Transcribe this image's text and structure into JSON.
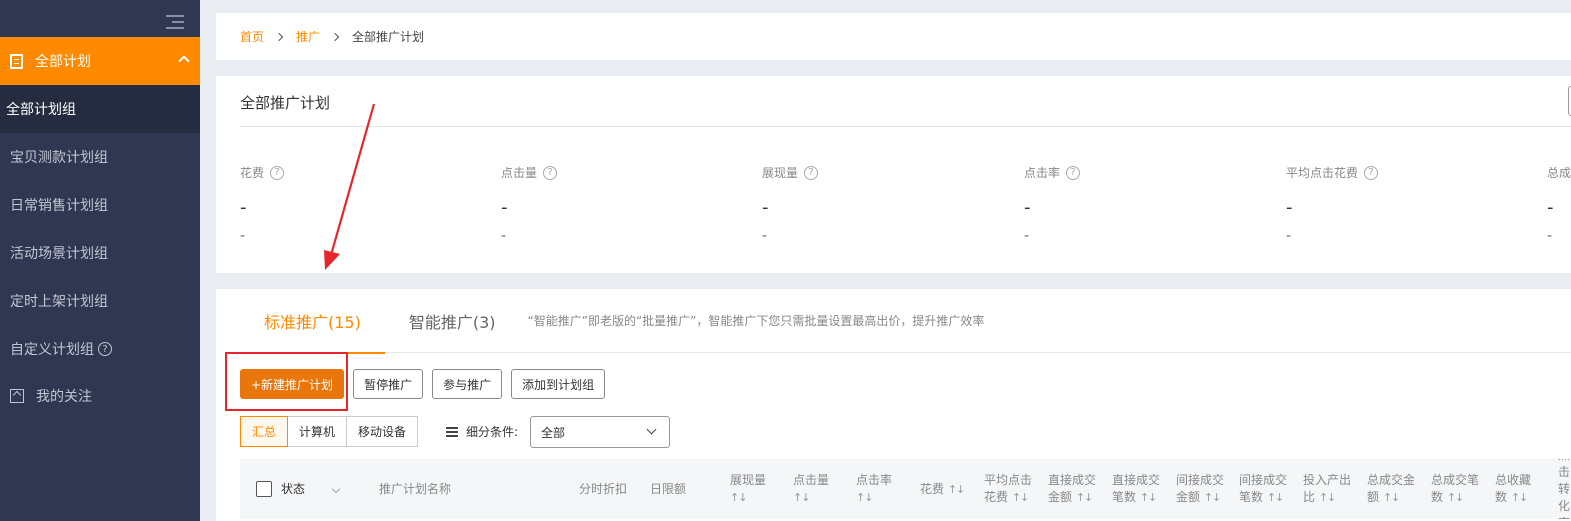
{
  "sidebar": {
    "header": "全部计划",
    "items": [
      {
        "label": "全部计划组"
      },
      {
        "label": "宝贝测款计划组"
      },
      {
        "label": "日常销售计划组"
      },
      {
        "label": "活动场景计划组"
      },
      {
        "label": "定时上架计划组"
      },
      {
        "label": "自定义计划组"
      }
    ],
    "bottom": "我的关注"
  },
  "breadcrumb": {
    "home": "首页",
    "promo": "推广",
    "current": "全部推广计划"
  },
  "overview": {
    "title": "全部推广计划",
    "metrics": [
      {
        "name": "花费",
        "v1": "-",
        "v2": "-"
      },
      {
        "name": "点击量",
        "v1": "-",
        "v2": "-"
      },
      {
        "name": "展现量",
        "v1": "-",
        "v2": "-"
      },
      {
        "name": "点击率",
        "v1": "-",
        "v2": "-"
      },
      {
        "name": "平均点击花费",
        "v1": "-",
        "v2": "-"
      },
      {
        "name": "总成",
        "v1": "-",
        "v2": "-"
      }
    ]
  },
  "tabs": {
    "standard": "标准推广(15)",
    "smart": "智能推广(3)",
    "note": "“智能推广”即老版的“批量推广”，智能推广下您只需批量设置最高出价，提升推广效率"
  },
  "buttons": {
    "new": "+新建推广计划",
    "pause": "暂停推广",
    "join": "参与推广",
    "add_group": "添加到计划组"
  },
  "segment": {
    "summary": "汇总",
    "pc": "计算机",
    "mobile": "移动设备"
  },
  "filter": {
    "label": "细分条件:",
    "value": "全部"
  },
  "table_headers": {
    "status": "状态",
    "name": "推广计划名称",
    "time": "分时折扣",
    "daily": "日限额",
    "impr": "展现量",
    "click": "点击量",
    "ctr": "点击率",
    "cost": "花费",
    "cpc": "平均点击花费",
    "d_amt": "直接成交金额",
    "d_cnt": "直接成交笔数",
    "i_amt": "间接成交金额",
    "i_cnt": "间接成交笔数",
    "roi": "投入产出比",
    "t_amt": "总成交金额",
    "t_cnt": "总成交笔数",
    "fav": "总收藏数",
    "last": "点击转化率",
    "sort": "↑↓"
  },
  "colors": {
    "accent": "#ff8a00",
    "sidebar": "#303750",
    "annotation": "#e5262a"
  }
}
